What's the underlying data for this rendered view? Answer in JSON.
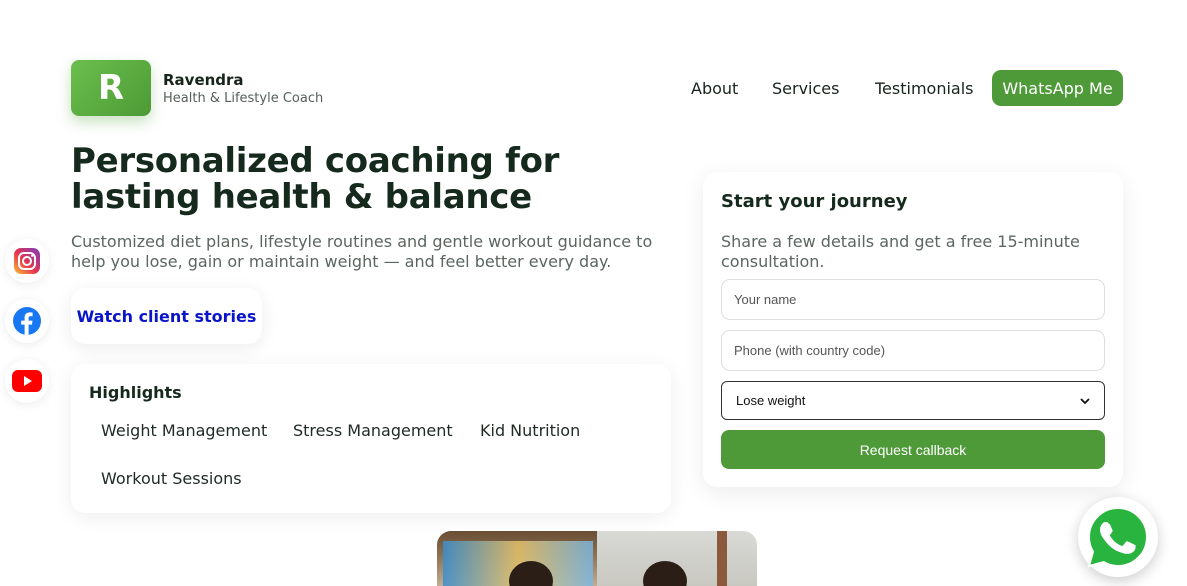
{
  "header": {
    "logo_letter": "R",
    "brand_name": "Ravendra",
    "brand_tagline": "Health & Lifestyle Coach",
    "nav": [
      "About",
      "Services",
      "Testimonials"
    ],
    "cta": "WhatsApp Me"
  },
  "hero": {
    "title": "Personalized coaching for lasting health & balance",
    "subtitle": "Customized diet plans, lifestyle routines and gentle workout guidance to help you lose, gain or maintain weight — and feel better every day.",
    "watch_label": "Watch client stories"
  },
  "highlights": {
    "title": "Highlights",
    "items": [
      "Weight Management",
      "Stress Management",
      "Kid Nutrition",
      "Workout Sessions"
    ]
  },
  "form": {
    "title": "Start your journey",
    "subtitle": "Share a few details and get a free 15-minute consultation.",
    "name_placeholder": "Your name",
    "phone_placeholder": "Phone (with country code)",
    "goal_selected": "Lose weight",
    "submit_label": "Request callback"
  },
  "social": [
    "instagram-icon",
    "facebook-icon",
    "youtube-icon"
  ],
  "colors": {
    "brand_green": "#4e9a38",
    "link_blue": "#0a14c8",
    "heading": "#15291d"
  }
}
